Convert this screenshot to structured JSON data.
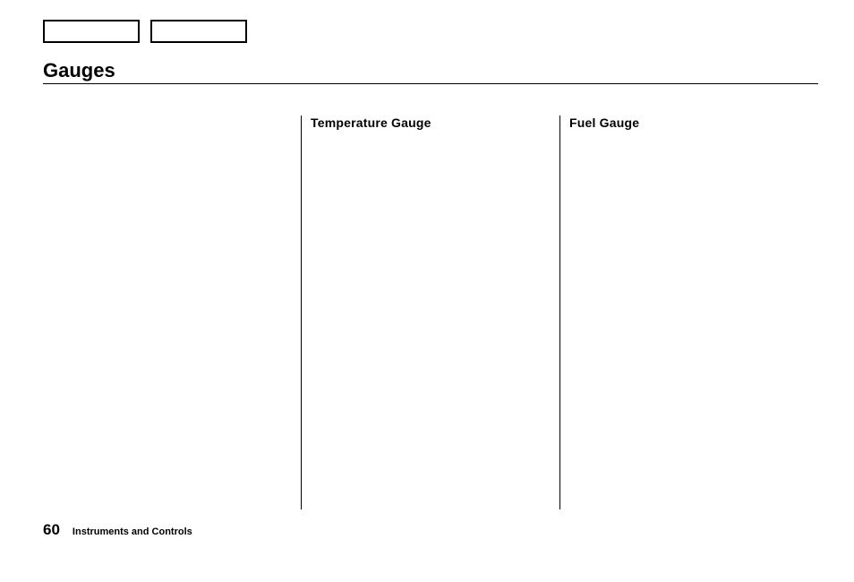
{
  "header": {
    "title": "Gauges"
  },
  "columns": {
    "col1_heading": "",
    "col2_heading": "Temperature Gauge",
    "col3_heading": "Fuel Gauge"
  },
  "footer": {
    "page_number": "60",
    "section": "Instruments and Controls"
  }
}
